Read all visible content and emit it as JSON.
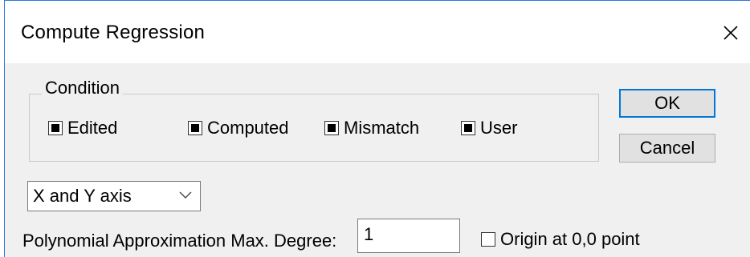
{
  "window": {
    "title": "Compute Regression"
  },
  "condition": {
    "label": "Condition",
    "checkboxes": [
      {
        "label": "Edited",
        "state": "indeterminate"
      },
      {
        "label": "Computed",
        "state": "indeterminate"
      },
      {
        "label": "Mismatch",
        "state": "indeterminate"
      },
      {
        "label": "User",
        "state": "indeterminate"
      }
    ]
  },
  "buttons": {
    "ok": "OK",
    "cancel": "Cancel"
  },
  "axis_select": {
    "value": "X and Y axis"
  },
  "degree": {
    "label": "Polynomial Approximation Max. Degree:",
    "value": "1"
  },
  "origin": {
    "label": "Origin at 0,0 point",
    "checked": false
  },
  "colors": {
    "accent": "#0078d7",
    "dialog_bg": "#f0f0f0"
  },
  "icons": [
    "close-icon",
    "chevron-down-icon"
  ]
}
